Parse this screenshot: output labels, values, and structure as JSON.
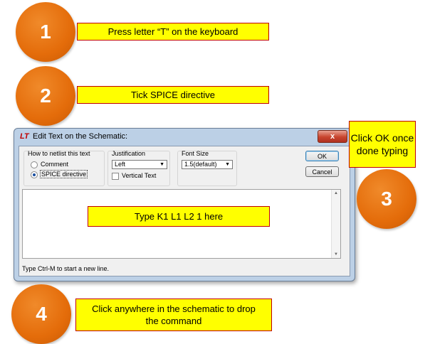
{
  "steps": [
    {
      "number": "1",
      "text": "Press letter “T” on the keyboard"
    },
    {
      "number": "2",
      "text": "Tick SPICE directive"
    },
    {
      "number": "3",
      "text": "Click OK once done typing"
    },
    {
      "number": "4",
      "text": "Click anywhere in the schematic to drop the command"
    }
  ],
  "inline_callout": "Type K1 L1 L2 1 here",
  "dialog": {
    "title": "Edit Text on the Schematic:",
    "logo": "LT",
    "close": "x",
    "netlist_group_label": "How to netlist this text",
    "radio_comment": "Comment",
    "radio_spice": "SPICE directive",
    "justification_label": "Justification",
    "justification_value": "Left",
    "vertical_text_label": "Vertical Text",
    "font_size_label": "Font Size",
    "font_size_value": "1.5(default)",
    "ok_label": "OK",
    "cancel_label": "Cancel",
    "status_text": "Type Ctrl-M to start a new line.",
    "selected_option": "SPICE directive"
  },
  "colors": {
    "accent_orange": "#e46c0a",
    "callout_yellow": "#ffff00",
    "callout_border": "#c00000"
  }
}
